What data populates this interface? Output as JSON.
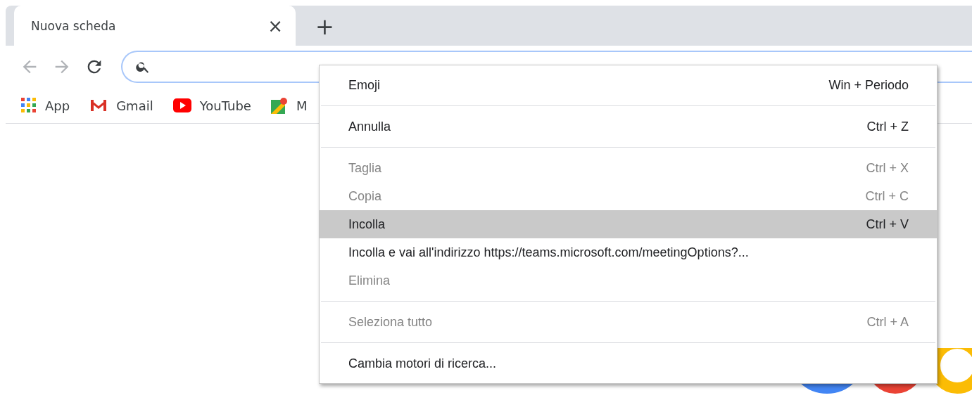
{
  "tabs": [
    {
      "title": "Nuova scheda",
      "selected": true,
      "close": "×"
    }
  ],
  "new_tab": "+",
  "toolbar": {
    "back_disabled": true,
    "forward_disabled": true
  },
  "bookmarks": [
    {
      "kind": "apps",
      "label": "App"
    },
    {
      "kind": "gmail",
      "label": "Gmail"
    },
    {
      "kind": "youtube",
      "label": "YouTube"
    },
    {
      "kind": "maps",
      "label": "M"
    }
  ],
  "context_menu": {
    "groups": [
      [
        {
          "label": "Emoji",
          "shortcut": "Win + Periodo",
          "disabled": false,
          "selected": false
        }
      ],
      [
        {
          "label": "Annulla",
          "shortcut": "Ctrl + Z",
          "disabled": false,
          "selected": false
        }
      ],
      [
        {
          "label": "Taglia",
          "shortcut": "Ctrl + X",
          "disabled": true,
          "selected": false
        },
        {
          "label": "Copia",
          "shortcut": "Ctrl + C",
          "disabled": true,
          "selected": false
        },
        {
          "label": "Incolla",
          "shortcut": "Ctrl + V",
          "disabled": false,
          "selected": true
        },
        {
          "label": "Incolla e vai all'indirizzo https://teams.microsoft.com/meetingOptions?...",
          "disabled": false,
          "selected": false
        },
        {
          "label": "Elimina",
          "disabled": true,
          "selected": false
        }
      ],
      [
        {
          "label": "Seleziona tutto",
          "shortcut": "Ctrl + A",
          "disabled": true,
          "selected": false
        }
      ],
      [
        {
          "label": "Cambia motori di ricerca...",
          "disabled": false,
          "selected": false
        }
      ]
    ]
  }
}
